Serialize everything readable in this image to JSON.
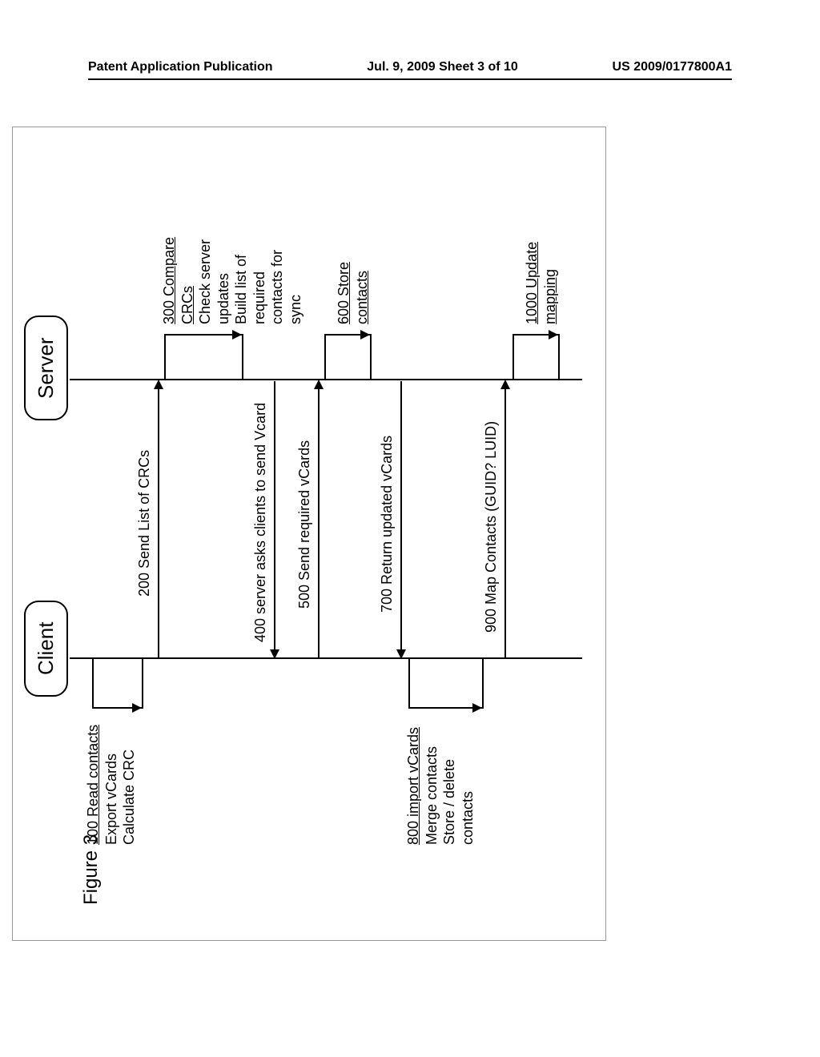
{
  "header": {
    "left": "Patent Application Publication",
    "center": "Jul. 9, 2009   Sheet 3 of 10",
    "right": "US 2009/0177800A1"
  },
  "figure_label": "Figure 3",
  "participants": {
    "client": "Client",
    "server": "Server"
  },
  "notes": {
    "n100_line1": "100 Read contacts",
    "n100_line2": "Export vCards",
    "n100_line3": "Calculate CRC",
    "n300_line1": "300 Compare CRCs",
    "n300_line2": "Check server updates",
    "n300_line3": "Build list of required",
    "n300_line4": "contacts for sync",
    "n600": "600 Store contacts",
    "n800_line1": "800 import vCards",
    "n800_line2": "Merge contacts",
    "n800_line3": "Store / delete",
    "n800_line4": "contacts",
    "n1000": "1000 Update mapping"
  },
  "messages": {
    "m200": "200 Send List of CRCs",
    "m400": "400 server asks clients to send Vcard",
    "m500": "500 Send required vCards",
    "m700": "700 Return updated vCards",
    "m900": "900 Map Contacts (GUID? LUID)"
  }
}
